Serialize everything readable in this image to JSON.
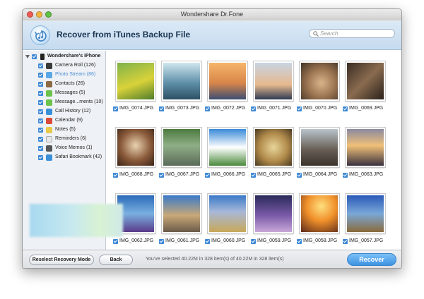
{
  "window": {
    "title": "Wondershare Dr.Fone"
  },
  "header": {
    "title": "Recover from iTunes Backup File",
    "search_placeholder": "Search"
  },
  "sidebar": {
    "root": "Wondershare's iPhone",
    "items": [
      {
        "label": "Camera Roll (126)",
        "icon": "camera-icon",
        "color": "#3a3a3a"
      },
      {
        "label": "Photo Stream (86)",
        "icon": "cloud-icon",
        "color": "#5aa7e6",
        "selected": true
      },
      {
        "label": "Contacts (26)",
        "icon": "contacts-icon",
        "color": "#8c6a45"
      },
      {
        "label": "Messages (5)",
        "icon": "message-icon",
        "color": "#6cc24a"
      },
      {
        "label": "Message...ments (10)",
        "icon": "attachment-icon",
        "color": "#6cc24a"
      },
      {
        "label": "Call History (12)",
        "icon": "phone-icon",
        "color": "#3b8fd9"
      },
      {
        "label": "Calendar (9)",
        "icon": "calendar-icon",
        "color": "#d94a3b"
      },
      {
        "label": "Notes (5)",
        "icon": "notes-icon",
        "color": "#e8c94a"
      },
      {
        "label": "Reminders (6)",
        "icon": "reminders-icon",
        "color": "#e8e8e8"
      },
      {
        "label": "Voice Memos (1)",
        "icon": "microphone-icon",
        "color": "#555555"
      },
      {
        "label": "Safari Bookmark (42)",
        "icon": "compass-icon",
        "color": "#3b8fd9"
      }
    ]
  },
  "photos": [
    {
      "name": "IMG_0074.JPG",
      "bg": "linear-gradient(160deg,#7fb24a,#d9d23a 55%,#4f7d2a)"
    },
    {
      "name": "IMG_0073.JPG",
      "bg": "linear-gradient(180deg,#cfe6ee,#5f8fa8 55%,#2d5064)"
    },
    {
      "name": "IMG_0072.JPG",
      "bg": "linear-gradient(180deg,#f6b56a,#d8864a 55%,#3c4d72)"
    },
    {
      "name": "IMG_0071.JPG",
      "bg": "linear-gradient(180deg,#c8d4e2,#e6b98e 60%,#2e3a52)"
    },
    {
      "name": "IMG_0070.JPG",
      "bg": "radial-gradient(circle at 55% 55%,#d8b48a,#9a7350 50%,#3f3326)"
    },
    {
      "name": "IMG_0069.JPG",
      "bg": "linear-gradient(135deg,#3a2c24,#8a6b4f 50%,#2a211b)"
    },
    {
      "name": "IMG_0068.JPG",
      "bg": "radial-gradient(circle at 50% 45%,#e8d2b0,#8a5a3a 55%,#3a2418)"
    },
    {
      "name": "IMG_0067.JPG",
      "bg": "linear-gradient(180deg,#4c7b3f,#8fae86 45%,#5a6a5a)"
    },
    {
      "name": "IMG_0066.JPG",
      "bg": "linear-gradient(180deg,#3a8ad8,#ffffff 50%,#4a8a3c)"
    },
    {
      "name": "IMG_0065.JPG",
      "bg": "radial-gradient(circle at 50% 50%,#e8d59a,#b08a4a 55%,#4a3a22)"
    },
    {
      "name": "IMG_0064.JPG",
      "bg": "linear-gradient(180deg,#b8c4cc,#6a6058 55%,#3a322c)"
    },
    {
      "name": "IMG_0063.JPG",
      "bg": "linear-gradient(180deg,#8a8aa0,#f0c078 45%,#3a3240)"
    },
    {
      "name": "IMG_0062.JPG",
      "bg": "linear-gradient(180deg,#2a6ab8,#7ab0e0 50%,#5a3a8a)"
    },
    {
      "name": "IMG_0061.JPG",
      "bg": "linear-gradient(180deg,#3a7ac8,#c8a878 55%,#6a5a4a)"
    },
    {
      "name": "IMG_0060.JPG",
      "bg": "linear-gradient(180deg,#3a7ac8,#a8b8d8 45%,#c8a858)"
    },
    {
      "name": "IMG_0059.JPG",
      "bg": "linear-gradient(180deg,#2a2a5a,#7a5aa8 55%,#c8a8d8)"
    },
    {
      "name": "IMG_0058.JPG",
      "bg": "radial-gradient(circle at 55% 30%,#ffe080,#f0902a 45%,#5a2a1a)"
    },
    {
      "name": "IMG_0057.JPG",
      "bg": "linear-gradient(180deg,#2a5ab8,#7aa8d8 50%,#8a6a3a)"
    },
    {
      "name": "",
      "bg": "linear-gradient(180deg,#d8d8d8,#b8b8b8)"
    },
    {
      "name": "",
      "bg": "linear-gradient(180deg,#d8d8d8,#b8b8b8)"
    },
    {
      "name": "",
      "bg": "linear-gradient(180deg,#d8d8d8,#b8b8b8)"
    },
    {
      "name": "",
      "bg": "linear-gradient(180deg,#d8d8d8,#b8b8b8)"
    },
    {
      "name": "",
      "bg": "linear-gradient(180deg,#d8d8d8,#b8b8b8)"
    },
    {
      "name": "",
      "bg": "linear-gradient(180deg,#d8d8d8,#b8b8b8)"
    }
  ],
  "footer": {
    "reselect_label": "Reselect Recovery Mode",
    "back_label": "Back",
    "status": "You've selected 40.22M in 328 item(s) of 40.22M in 328 item(s)",
    "recover_label": "Recover"
  },
  "colors": {
    "accent": "#3d88d6",
    "header_bg": "#c6dbef"
  }
}
